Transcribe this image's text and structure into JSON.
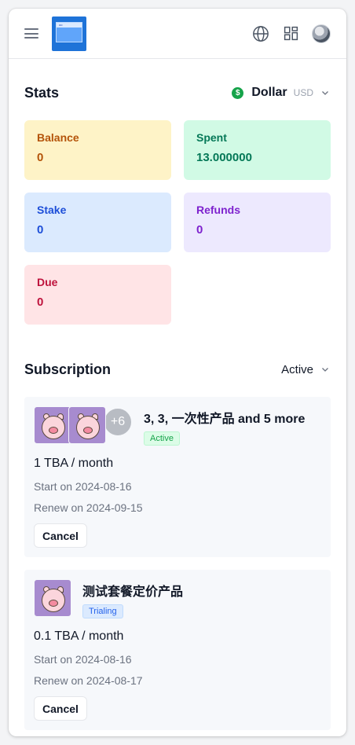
{
  "header": {
    "menu_icon": "hamburger-icon",
    "logo_icon": "app-logo-icon",
    "language_icon": "globe-icon",
    "apps_icon": "grid-icon",
    "avatar_icon": "user-avatar"
  },
  "stats": {
    "title": "Stats",
    "currency": {
      "symbol": "$",
      "name": "Dollar",
      "code": "USD"
    },
    "cards": [
      {
        "label": "Balance",
        "value": "0",
        "bg": "#fef3c7",
        "color": "#b45309"
      },
      {
        "label": "Spent",
        "value": "13.000000",
        "bg": "#d1fae5",
        "color": "#047857"
      },
      {
        "label": "Stake",
        "value": "0",
        "bg": "#dbeafe",
        "color": "#1d4ed8"
      },
      {
        "label": "Refunds",
        "value": "0",
        "bg": "#ede9fe",
        "color": "#7e22ce"
      },
      {
        "label": "Due",
        "value": "0",
        "bg": "#ffe4e6",
        "color": "#be123c"
      }
    ]
  },
  "subscription": {
    "title": "Subscription",
    "filter": "Active",
    "items": [
      {
        "name": "3, 3, 一次性产品 and 5 more",
        "status": "Active",
        "more": "+6",
        "price": "1 TBA / month",
        "start": "Start on 2024-08-16",
        "renew": "Renew on 2024-09-15",
        "cancel": "Cancel"
      },
      {
        "name": "测试套餐定价产品",
        "status": "Trialing",
        "price": "0.1 TBA / month",
        "start": "Start on 2024-08-16",
        "renew": "Renew on 2024-08-17",
        "cancel": "Cancel"
      }
    ]
  }
}
